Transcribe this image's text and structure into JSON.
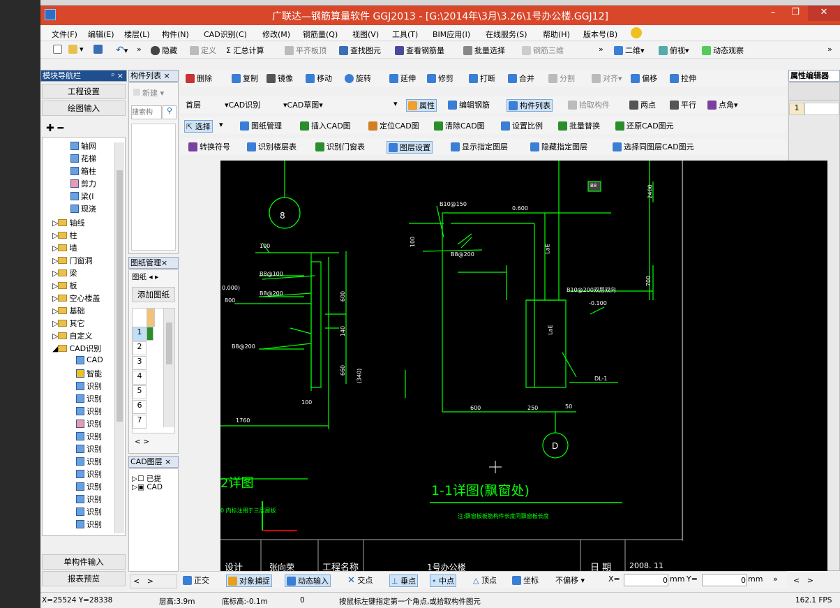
{
  "title": "广联达—钢筋算量软件 GGJ2013 - [G:\\2014年\\3月\\3.26\\1号办公楼.GGJ12]",
  "window_controls": {
    "minimize": "–",
    "restore": "❐",
    "close": "✕"
  },
  "menu": [
    "文件(F)",
    "编辑(E)",
    "楼层(L)",
    "构件(N)",
    "CAD识别(C)",
    "修改(M)",
    "钢筋量(Q)",
    "视图(V)",
    "工具(T)",
    "BIM应用(I)",
    "在线服务(S)",
    "帮助(H)",
    "版本号(B)"
  ],
  "toolbar1": {
    "hide": "隐藏",
    "define": "定义",
    "sum": "Σ 汇总计算",
    "flat_top": "平齐板顶",
    "find": "查找图元",
    "view_rebar": "查看钢筋量",
    "batch_select": "批量选择",
    "rebar_3d": "钢筋三维",
    "view2d": "二维",
    "bird_view": "俯视",
    "dynamic": "动态观察",
    "more": "»"
  },
  "left_nav": {
    "title": "模块导航栏",
    "pin": "ᵖ ×",
    "project_settings": "工程设置",
    "drawing_input": "绘图输入",
    "tree": [
      "轴网",
      "花梯",
      "箱柱",
      "剪力",
      "梁(I",
      "现浇",
      "轴线",
      "柱",
      "墙",
      "门窗洞",
      "梁",
      "板",
      "空心楼盖",
      "基础",
      "其它",
      "自定义",
      "CAD识别",
      "CAD",
      "智能",
      "识别",
      "识别",
      "识别",
      "识别",
      "识别",
      "识别",
      "识别",
      "识别",
      "识别",
      "识别",
      "识别",
      "识别"
    ],
    "single_input": "单构件输入",
    "report_preview": "报表预览"
  },
  "component_list": {
    "title": "构件列表",
    "new": "新建",
    "search_placeholder": "搜索构"
  },
  "drawing_mgmt": {
    "title": "图纸管理",
    "tab": "图纸",
    "add": "添加图纸",
    "rows": [
      "1",
      "2",
      "3",
      "4",
      "5",
      "6",
      "7"
    ],
    "nav": "< >"
  },
  "cad_layer": {
    "title": "CAD图层",
    "items": [
      "已提",
      "CAD"
    ]
  },
  "edit_toolbar": {
    "delete": "删除",
    "copy": "复制",
    "mirror": "镜像",
    "move": "移动",
    "rotate": "旋转",
    "extend": "延伸",
    "trim": "修剪",
    "break": "打断",
    "merge": "合并",
    "split": "分割",
    "align": "对齐",
    "offset": "偏移",
    "stretch": "拉伸"
  },
  "floor_toolbar": {
    "floor": "首层",
    "cad_recognize": "CAD识别",
    "cad_sketch": "CAD草图",
    "property": "属性",
    "edit_rebar": "编辑钢筋",
    "comp_list": "构件列表",
    "pick": "拾取构件",
    "two_point": "两点",
    "parallel": "平行",
    "angle": "点角"
  },
  "select_toolbar": {
    "select": "选择",
    "drawing_mgmt": "图纸管理",
    "insert_cad": "插入CAD图",
    "locate_cad": "定位CAD图",
    "clear_cad": "清除CAD图",
    "set_scale": "设置比例",
    "batch_replace": "批量替换",
    "restore_cad": "还原CAD图元"
  },
  "convert_toolbar": {
    "convert": "转换符号",
    "recog_floor": "识别楼层表",
    "recog_door": "识别门窗表",
    "layer_settings": "图层设置",
    "show_layer": "显示指定图层",
    "hide_layer": "隐藏指定图层",
    "select_same": "选择同图层CAD图元"
  },
  "right_panel": {
    "title": "属性编辑器",
    "row": "1"
  },
  "cad": {
    "label_8": "8",
    "label_d": "D",
    "dims": [
      "100",
      "B8@100",
      "B8@200",
      "B8@200",
      "600",
      "140",
      "660",
      "(340)",
      "100",
      "1760",
      "B10@150",
      "0.600",
      "100",
      "B8@200",
      "LaE",
      "B10@200双层双向",
      "-0.100",
      "LaE",
      "600",
      "250",
      "50",
      "DL-1",
      "2400",
      "700"
    ],
    "left_elev": [
      "0.000)",
      "800"
    ],
    "title_left": "2详图",
    "note_left": "0 内标注用于三层屋板",
    "title_main": "1-1详图(飘窗处)",
    "note_main": "注:飘窗板板筋构件长度同飘窗板长度",
    "box_label": "B8"
  },
  "title_block": {
    "design": "设计",
    "designer": "张向荣",
    "project_name": "工程名称",
    "project": "1号办公楼",
    "date": "日 期",
    "date_val": "2008. 11"
  },
  "snap_toolbar": {
    "ortho": "正交",
    "snap": "对象捕捉",
    "dynamic": "动态输入",
    "intersect": "交点",
    "perp": "垂点",
    "mid": "中点",
    "vertex": "顶点",
    "coord": "坐标",
    "no_offset": "不偏移",
    "x_label": "X=",
    "x_val": "0",
    "mm1": "mm",
    "y_label": "Y=",
    "y_val": "0",
    "mm2": "mm"
  },
  "status": {
    "coords": "X=25524 Y=28338",
    "floor_height": "层高:3.9m",
    "base_height": "底标高:-0.1m",
    "zero": "0",
    "hint": "按鼠标左键指定第一个角点,或拾取构件图元",
    "fps": "162.1 FPS"
  }
}
